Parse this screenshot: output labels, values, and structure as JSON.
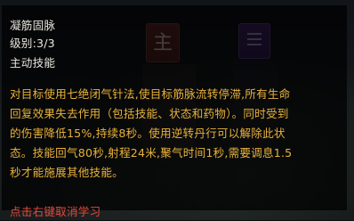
{
  "skill": {
    "name": "凝筋固脉",
    "level": "级别:3/3",
    "type": "主动技能",
    "description_lines": [
      "对目标使用七绝闭气针法,使目标筋脉流转停滞,所有生命",
      "回复效果失去作用（包括技能、状态和药物）。同时受到",
      "的伤害降低15%,持续8秒。使用逆转丹行可以解除此状",
      "态。技能回气80秒,射程24米,聚气时间1秒,需要调息1.5",
      "秒才能施展其他技能。"
    ],
    "cancel_hint": "点击右键取消学习"
  },
  "background": {
    "red_icon_glyph": "主"
  },
  "colors": {
    "header_text": "#e9e6df",
    "description_text": "#e8b23a",
    "cancel_text": "#e04a3a"
  }
}
